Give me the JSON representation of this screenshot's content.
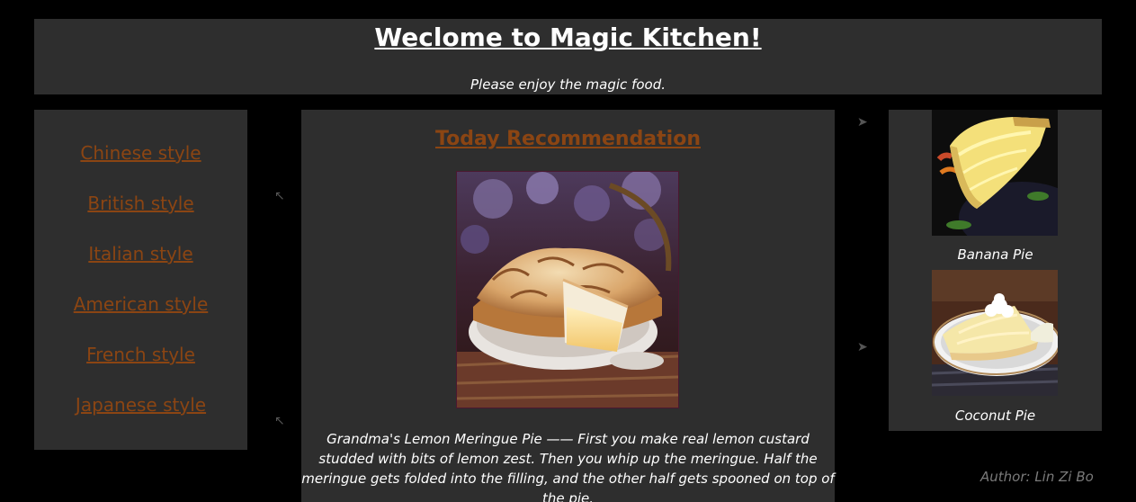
{
  "header": {
    "title": "Weclome to Magic Kitchen!",
    "subtitle": "Please enjoy the magic food."
  },
  "sidebar": {
    "items": [
      {
        "label": "Chinese style"
      },
      {
        "label": "British style"
      },
      {
        "label": "Italian style"
      },
      {
        "label": "American style"
      },
      {
        "label": "French style"
      },
      {
        "label": "Japanese style"
      }
    ]
  },
  "main": {
    "heading": "Today Recommendation",
    "image_alt": "Lemon meringue pie",
    "description": "Grandma's Lemon Meringue Pie —— First you make real lemon custard studded with bits of lemon zest. Then you whip up the meringue. Half the meringue gets folded into the filling, and the other half gets spooned on top of the pie."
  },
  "rightbar": {
    "items": [
      {
        "label": "Banana Pie"
      },
      {
        "label": "Coconut Pie"
      }
    ]
  },
  "footer": {
    "author": "Author: Lin Zi Bo"
  },
  "colors": {
    "page_background": "#000000",
    "panel_background": "#2e2e2e",
    "link": "#8b4513",
    "text": "#ffffff",
    "author_text": "#7a7a7a"
  }
}
